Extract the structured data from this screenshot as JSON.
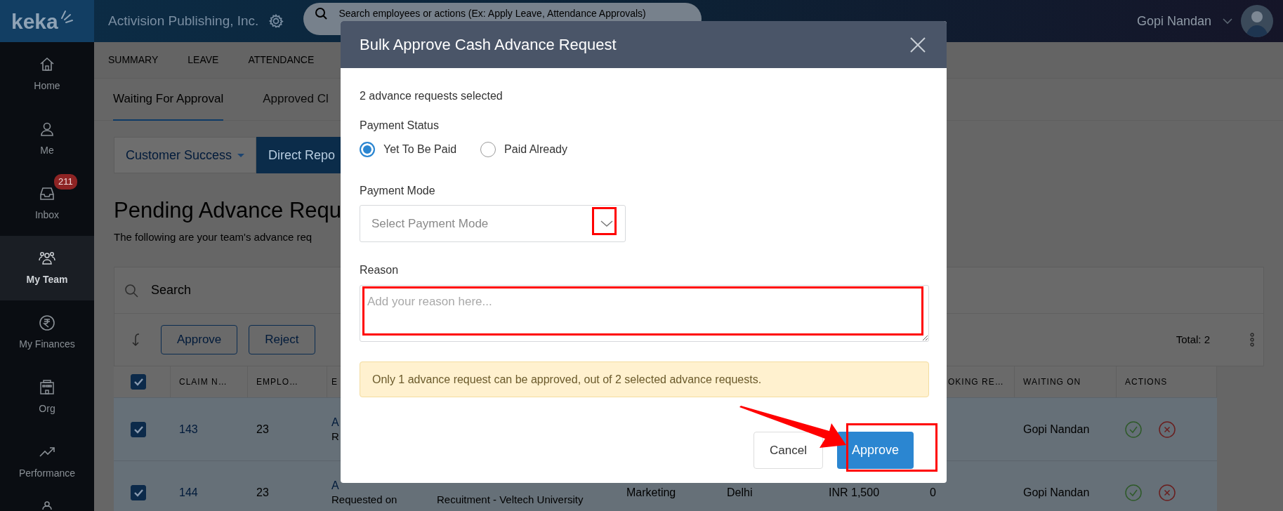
{
  "topbar": {
    "logo": "keka",
    "company": "Activision Publishing, Inc.",
    "search_placeholder": "Search employees or actions (Ex: Apply Leave, Attendance Approvals)",
    "user": "Gopi Nandan"
  },
  "sidebar": {
    "items": [
      {
        "label": "Home",
        "selected": false
      },
      {
        "label": "Me",
        "selected": false
      },
      {
        "label": "Inbox",
        "badge": "211",
        "selected": false
      },
      {
        "label": "My Team",
        "selected": true
      },
      {
        "label": "My Finances",
        "selected": false
      },
      {
        "label": "Org",
        "selected": false
      },
      {
        "label": "Performance",
        "selected": false
      },
      {
        "selected": false
      }
    ]
  },
  "nav_tabs": [
    {
      "label": "SUMMARY",
      "selected": false
    },
    {
      "label": "LEAVE",
      "selected": false
    },
    {
      "label": "ATTENDANCE",
      "selected": false
    }
  ],
  "sub_tabs": [
    {
      "label": "Waiting For Approval",
      "selected": true
    },
    {
      "label": "Approved Cl",
      "selected": false
    }
  ],
  "filters": [
    {
      "label": "Customer Success",
      "kind": "dropdown",
      "selected": false
    },
    {
      "label": "Direct Repo",
      "kind": "button",
      "selected": true
    }
  ],
  "page": {
    "title": "Pending Advance Requ",
    "subtitle": "The following are your team's advance req"
  },
  "search": {
    "placeholder": "Search"
  },
  "toolbar": {
    "buttons": [
      "Approve",
      "Reject"
    ],
    "total": "Total: 2"
  },
  "table": {
    "select_all_checked": true,
    "columns": [
      "CLAIM N…",
      "EMPLO…",
      "E",
      null,
      null,
      null,
      null,
      "OKING RE…",
      "WAITING ON",
      "ACTIONS"
    ],
    "rows": [
      {
        "checked": true,
        "cells": [
          {
            "kind": "link",
            "text": "143"
          },
          {
            "kind": "text",
            "text": "23"
          },
          {
            "kind": "stack",
            "link": "A",
            "note": "R"
          },
          null,
          null,
          null,
          null,
          null,
          {
            "kind": "text",
            "text": "Gopi Nandan"
          },
          {
            "kind": "actions"
          }
        ]
      },
      {
        "checked": true,
        "cells": [
          {
            "kind": "link",
            "text": "144"
          },
          {
            "kind": "text",
            "text": "23"
          },
          {
            "kind": "stack",
            "link": "A",
            "note": "Requested on"
          },
          {
            "kind": "stack",
            "note": "Recuitment - Veltech University"
          },
          {
            "kind": "text",
            "text": "Marketing"
          },
          {
            "kind": "text",
            "text": "Delhi"
          },
          {
            "kind": "text",
            "text": "INR 1,500"
          },
          {
            "kind": "text",
            "text": "0"
          },
          {
            "kind": "text",
            "text": "Gopi Nandan"
          },
          {
            "kind": "actions"
          }
        ]
      }
    ]
  },
  "dialog": {
    "title": "Bulk Approve Cash Advance Request",
    "selection_note": "2 advance requests selected",
    "payment_status": {
      "label": "Payment Status",
      "options": [
        {
          "label": "Yet To Be Paid",
          "selected": true
        },
        {
          "label": "Paid Already",
          "selected": false
        }
      ]
    },
    "payment_mode": {
      "label": "Payment Mode",
      "placeholder": "Select Payment Mode"
    },
    "reason": {
      "label": "Reason",
      "placeholder": "Add your reason here..."
    },
    "warning": "Only 1 advance request can be approved, out of 2 selected advance requests.",
    "buttons": [
      {
        "label": "Cancel",
        "kind": "secondary"
      },
      {
        "label": "Approve",
        "kind": "primary"
      }
    ]
  }
}
